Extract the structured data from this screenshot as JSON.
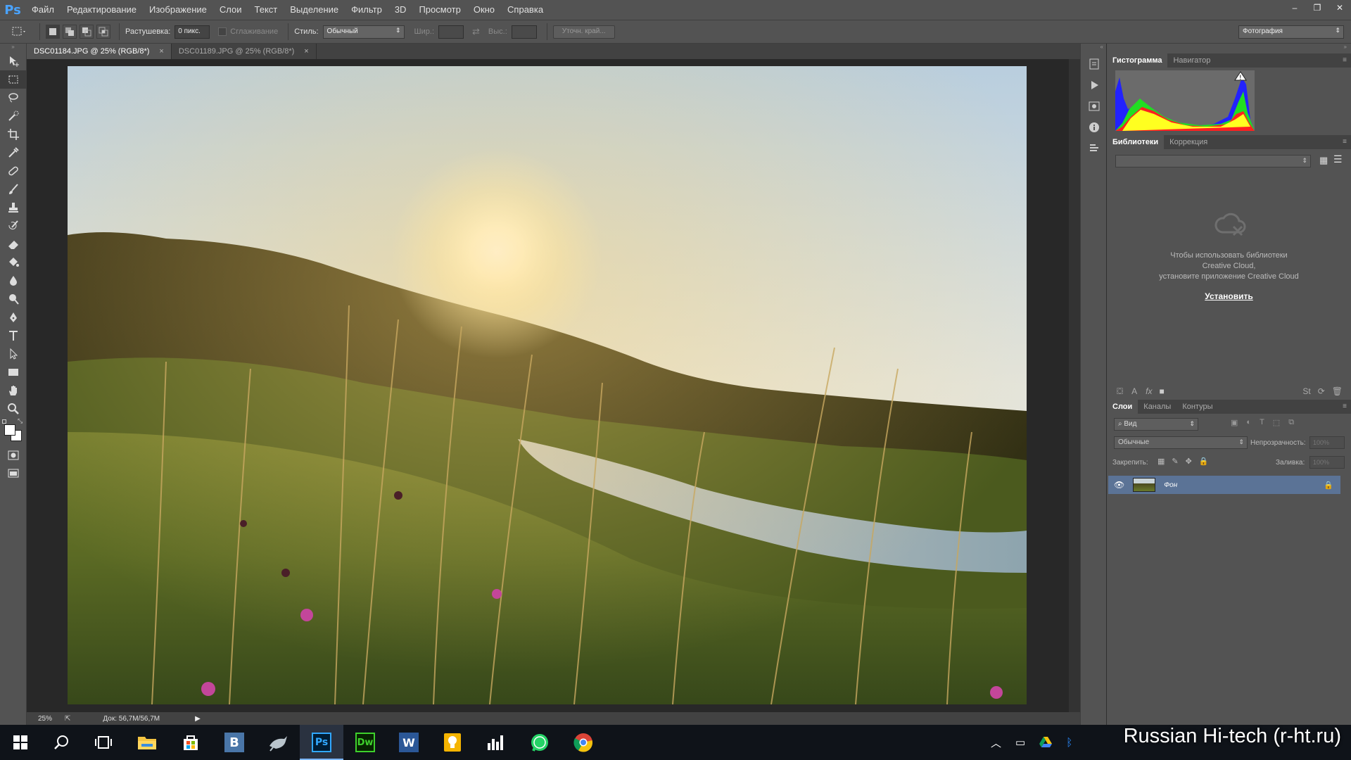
{
  "app": {
    "logo": "Ps"
  },
  "menu": [
    "Файл",
    "Редактирование",
    "Изображение",
    "Слои",
    "Текст",
    "Выделение",
    "Фильтр",
    "3D",
    "Просмотр",
    "Окно",
    "Справка"
  ],
  "window_controls": {
    "minimize": "–",
    "restore": "❐",
    "close": "✕"
  },
  "options": {
    "feather_label": "Растушевка:",
    "feather_value": "0 пикс.",
    "antialias_label": "Сглаживание",
    "style_label": "Стиль:",
    "style_value": "Обычный",
    "width_label": "Шир.:",
    "height_label": "Выс.:",
    "refine_edge": "Уточн. край...",
    "workspace": "Фотография"
  },
  "documents": [
    {
      "title": "DSC01184.JPG @ 25% (RGB/8*)",
      "active": true
    },
    {
      "title": "DSC01189.JPG @ 25% (RGB/8*)",
      "active": false
    }
  ],
  "status": {
    "zoom": "25%",
    "doc": "Док: 56,7M/56,7M"
  },
  "panels": {
    "top_tabs": [
      "Гистограмма",
      "Навигатор"
    ],
    "mid_tabs": [
      "Библиотеки",
      "Коррекция"
    ],
    "library_message": [
      "Чтобы использовать библиотеки",
      "Creative Cloud,",
      "установите приложение Creative Cloud"
    ],
    "install_link": "Установить",
    "layer_tabs": [
      "Слои",
      "Каналы",
      "Контуры"
    ],
    "filter_kind": "Вид",
    "blend_mode": "Обычные",
    "opacity_label": "Непрозрачность:",
    "opacity_value": "100%",
    "lock_label": "Закрепить:",
    "fill_label": "Заливка:",
    "fill_value": "100%",
    "layer_name": "Фон"
  },
  "taskbar": {
    "items": [
      "windows-start",
      "search",
      "task-view",
      "file-explorer",
      "store",
      "vk",
      "mail",
      "photoshop",
      "dreamweaver",
      "word",
      "tips",
      "charts",
      "whatsapp",
      "chrome"
    ],
    "active": "photoshop"
  },
  "watermark": "Russian Hi-tech (r-ht.ru)",
  "colors": {
    "ps_blue": "#4aa3ff",
    "dw_green": "#3ed02c",
    "word_blue": "#2b5797",
    "layer_selected": "#5b7396"
  }
}
